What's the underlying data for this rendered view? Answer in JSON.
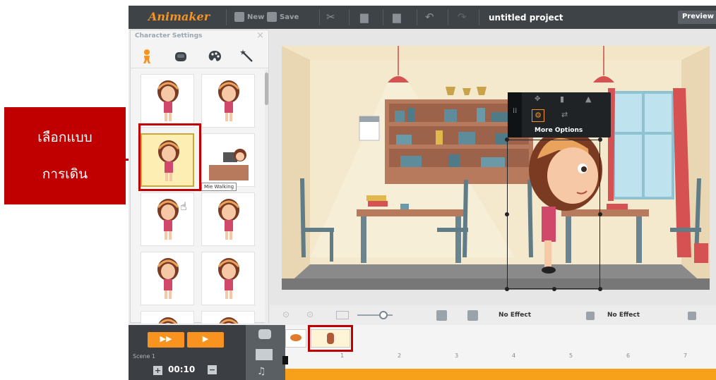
{
  "callout": {
    "line1": "เลือกแบบ",
    "line2": "การเดิน"
  },
  "toolbar": {
    "logo": "Animaker",
    "new_label": "New",
    "save_label": "Save",
    "project_title": "untitled project",
    "preview_label": "Preview"
  },
  "panel": {
    "title": "Character Settings",
    "close": "×",
    "tabs": [
      "character-tab",
      "accessory-tab",
      "color-tab",
      "effects-tab"
    ],
    "tooltip": "Mie Walking"
  },
  "canvas": {
    "more_options_label": "More Options"
  },
  "controls": {
    "effect_in": "No Effect",
    "effect_out": "No Effect"
  },
  "timeline": {
    "scene_label": "Scene 1",
    "duration": "00:10",
    "plus": "+",
    "minus": "−",
    "ruler_ticks": [
      "1",
      "2",
      "3",
      "4",
      "5",
      "6",
      "7"
    ]
  },
  "colors": {
    "accent": "#f7931e",
    "toolbar": "#3e4348",
    "callout": "#c00000",
    "selected_tile": "#fdeeb4"
  }
}
